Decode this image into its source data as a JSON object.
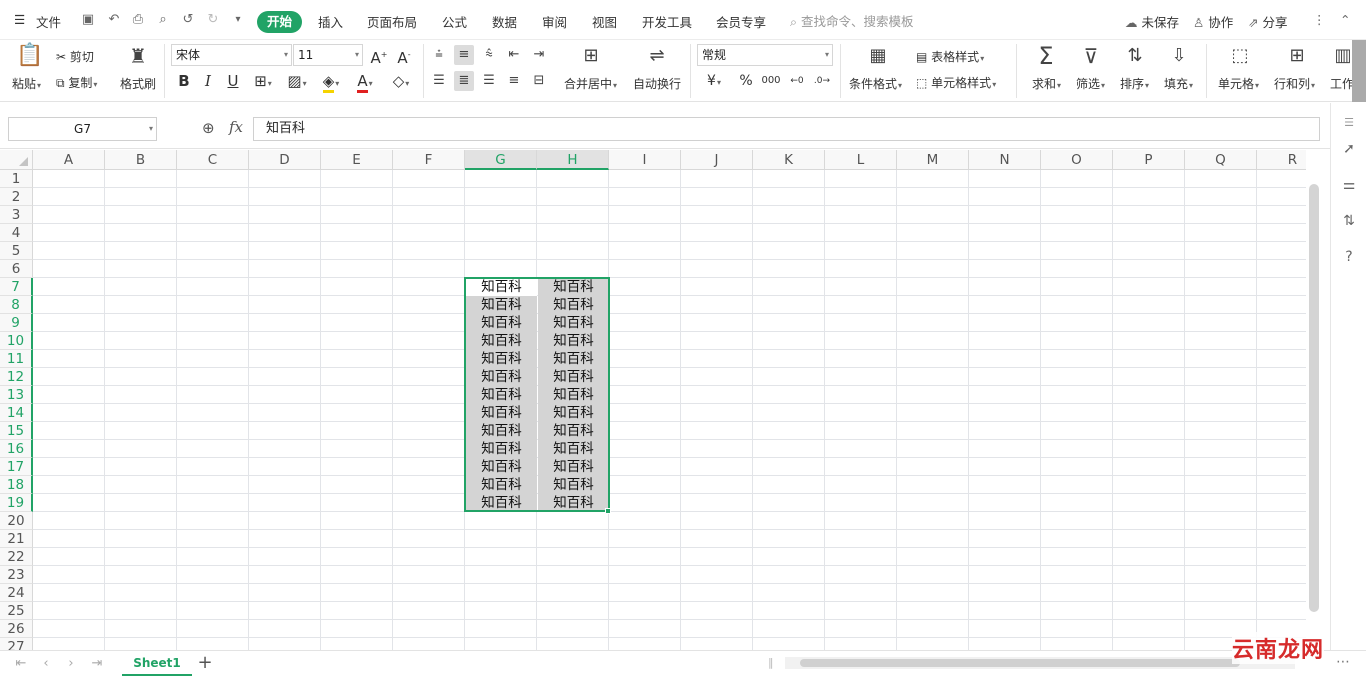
{
  "menu": {
    "file": "文件",
    "tabs": [
      "开始",
      "插入",
      "页面布局",
      "公式",
      "数据",
      "审阅",
      "视图",
      "开发工具",
      "会员专享"
    ],
    "search_placeholder": "查找命令、搜索模板",
    "unsaved": "未保存",
    "collaborate": "协作",
    "share": "分享"
  },
  "ribbon": {
    "paste": "粘贴",
    "cut": "剪切",
    "copy": "复制",
    "format_painter": "格式刷",
    "font_name": "宋体",
    "font_size": "11",
    "merge_center": "合并居中",
    "wrap_text": "自动换行",
    "number_format": "常规",
    "conditional_format": "条件格式",
    "table_style": "表格样式",
    "cell_style": "单元格样式",
    "sum": "求和",
    "filter": "筛选",
    "sort": "排序",
    "fill": "填充",
    "cell": "单元格",
    "row_col": "行和列",
    "worksheet": "工作"
  },
  "formula_bar": {
    "name_box": "G7",
    "fx": "fx",
    "value": "知百科"
  },
  "grid": {
    "columns": [
      "A",
      "B",
      "C",
      "D",
      "E",
      "F",
      "G",
      "H",
      "I",
      "J",
      "K",
      "L",
      "M",
      "N",
      "O",
      "P",
      "Q",
      "R"
    ],
    "rows": [
      "1",
      "2",
      "3",
      "4",
      "5",
      "6",
      "7",
      "8",
      "9",
      "10",
      "11",
      "12",
      "13",
      "14",
      "15",
      "16",
      "17",
      "18",
      "19",
      "20",
      "21",
      "22",
      "23",
      "24",
      "25",
      "26",
      "27"
    ],
    "selected_columns": [
      "G",
      "H"
    ],
    "selected_rows": [
      "7",
      "8",
      "9",
      "10",
      "11",
      "12",
      "13",
      "14",
      "15",
      "16",
      "17",
      "18",
      "19"
    ],
    "active_cell": "G7",
    "cell_text": "知百科",
    "filled_range": "G7:H19"
  },
  "sheets": {
    "tabs": [
      "Sheet1"
    ],
    "active": "Sheet1"
  },
  "watermark": "云南龙网",
  "colors": {
    "accent": "#21a366",
    "selection_fill": "#d4d4d4",
    "watermark": "#d62b2b"
  }
}
